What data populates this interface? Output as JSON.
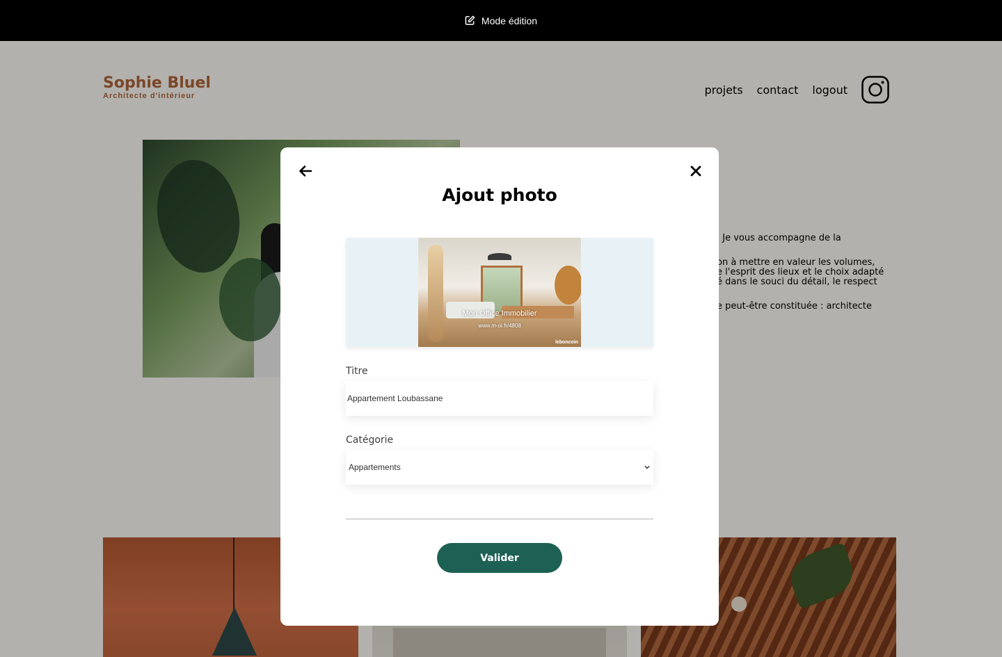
{
  "edit_bar": {
    "label": "Mode édition",
    "icon": "edit-icon"
  },
  "header": {
    "logo_name": "Sophie Bluel",
    "logo_subtitle": "Architecte d'intérieur",
    "nav": {
      "projects": "projets",
      "contact": "contact",
      "logout": "logout"
    },
    "social_icon": "instagram-icon"
  },
  "about": {
    "line1": ". Je vous accompagne de la",
    "line2": "on à mettre en valeur les volumes,",
    "line3": "e l'esprit des lieux et le choix adapté",
    "line4": "é dans le souci du détail, le respect",
    "line5": "e peut-être constituée : architecte"
  },
  "modal": {
    "title": "Ajout photo",
    "back_icon": "arrow-left-icon",
    "close_icon": "close-icon",
    "preview": {
      "caption": "Mon Office Immobilier",
      "caption_url": "www.m-oi.fr/4808",
      "brand": "leboncoin"
    },
    "title_label": "Titre",
    "title_value": "Appartement Loubassane",
    "category_label": "Catégorie",
    "category_value": "Appartements",
    "submit_label": "Valider"
  },
  "colors": {
    "brand": "#b1663c",
    "button": "#1d6154",
    "overlay": "rgba(0,0,0,0.3)"
  }
}
